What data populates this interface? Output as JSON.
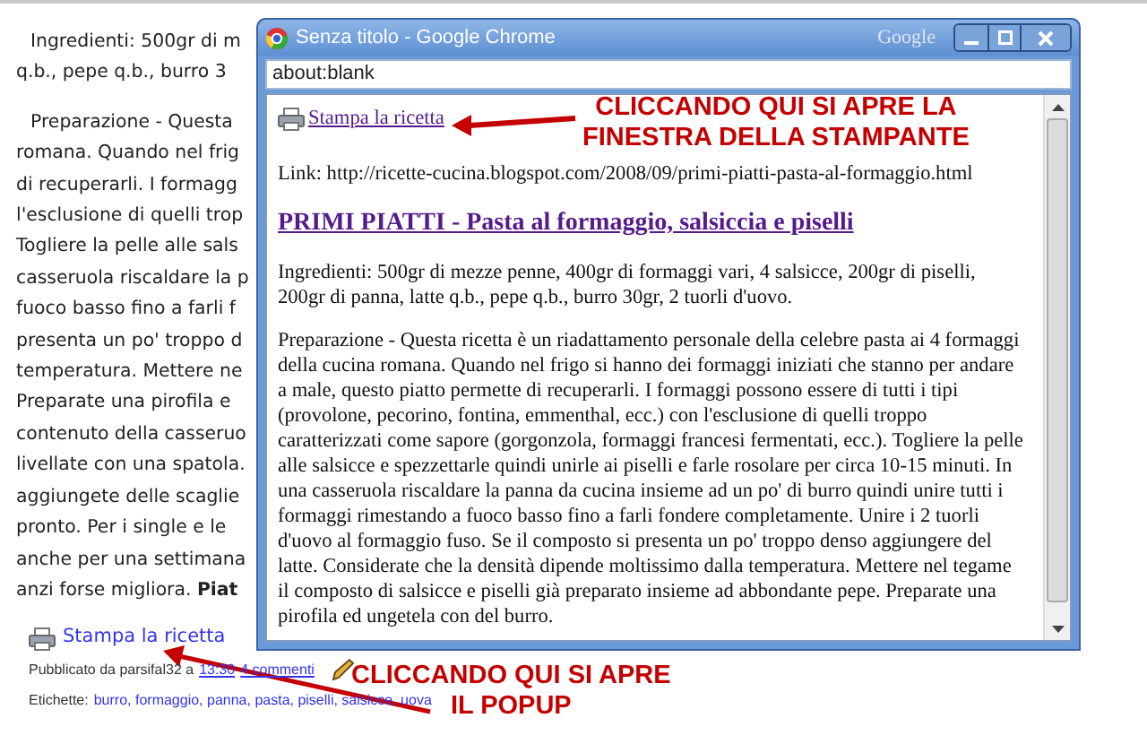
{
  "blog": {
    "paragraphs": [
      [
        "Ingredienti: 500gr di m",
        "q.b., pepe q.b., burro 3"
      ],
      [
        "Preparazione - Questa",
        "romana. Quando nel frig",
        "di recuperarli. I formagg",
        "l'esclusione di quelli trop",
        "Togliere la pelle alle sals",
        "casseruola riscaldare la p",
        "fuoco basso fino a farli f",
        "presenta un po' troppo d",
        "temperatura. Mettere ne",
        "Preparate una pirofila e",
        "contenuto della casseruo",
        "livellate con una spatola.",
        "aggiungete delle scaglie",
        "pronto. Per i single e le",
        "anche per una settimana",
        "anzi forse migliora. **Piat**"
      ]
    ],
    "print_link": "Stampa la ricetta",
    "post_meta": {
      "prefix": "Pubblicato da parsifal32 a",
      "time": "13:30",
      "comments": "4 commenti"
    },
    "labels": {
      "caption": "Etichette:",
      "tags": "burro, formaggio, panna, pasta, piselli, salsicce, uova"
    }
  },
  "popup": {
    "title": "Senza titolo - Google Chrome",
    "brand": "Google",
    "address": "about:blank",
    "print_link": "Stampa la ricetta",
    "link_line": "Link: http://ricette-cucina.blogspot.com/2008/09/primi-piatti-pasta-al-formaggio.html",
    "heading": "PRIMI PIATTI - Pasta al formaggio, salsiccia e piselli",
    "paragraphs": [
      "Ingredienti: 500gr di mezze penne, 400gr di formaggi vari, 4 salsicce, 200gr di piselli, 200gr di panna, latte q.b., pepe q.b., burro 30gr, 2 tuorli d'uovo.",
      "Preparazione - Questa ricetta è un riadattamento personale della celebre pasta ai 4 formaggi della cucina romana. Quando nel frigo si hanno dei formaggi iniziati che stanno per andare a male, questo piatto permette di recuperarli. I formaggi possono essere di tutti i tipi (provolone, pecorino, fontina, emmenthal, ecc.) con l'esclusione di quelli troppo caratterizzati come sapore (gorgonzola, formaggi francesi fermentati, ecc.). Togliere la pelle alle salsicce e spezzettarle quindi unirle ai piselli e farle rosolare per circa 10-15 minuti. In una casseruola riscaldare la panna da cucina insieme ad un po' di burro quindi unire tutti i formaggi rimestando a fuoco basso fino a farli fondere completamente. Unire i 2 tuorli d'uovo al formaggio fuso. Se il composto si presenta un po' troppo denso aggiungere del latte. Considerate che la densità dipende moltissimo dalla temperatura. Mettere nel tegame il composto di salsicce e piselli già preparato insieme ad abbondante pepe. Preparate una pirofila ed ungetela con del burro."
    ]
  },
  "annotations": [
    {
      "kind": "top",
      "lines": [
        "CLICCANDO QUI SI APRE LA",
        "FINESTRA DELLA STAMPANTE"
      ]
    },
    {
      "kind": "bottom",
      "lines": [
        "CLICCANDO QUI SI APRE",
        "IL POPUP"
      ]
    }
  ]
}
